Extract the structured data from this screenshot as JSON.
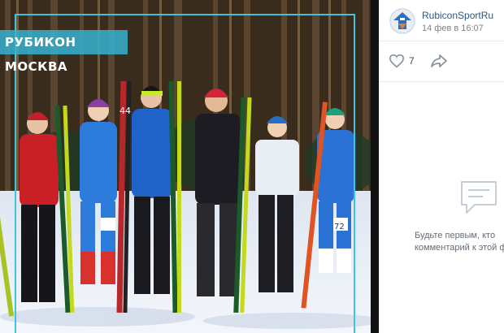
{
  "photo": {
    "caption": "РУБИКОН МОСКВА",
    "bib_numbers": [
      "44",
      "72"
    ]
  },
  "post": {
    "author": "RubiconSportRu",
    "date": "14 фев в 16:07",
    "likes": "7",
    "empty_comments_line1": "Будьте первым, кто",
    "empty_comments_line2": "комментарий к этой ф"
  },
  "colors": {
    "link": "#2a5885",
    "accent_frame": "#3fc3e0",
    "muted_text": "#828282"
  },
  "icons": {
    "like": "heart-icon",
    "share": "share-arrow-icon",
    "empty": "comment-bubble-icon",
    "avatar": "rubicon-logo"
  }
}
